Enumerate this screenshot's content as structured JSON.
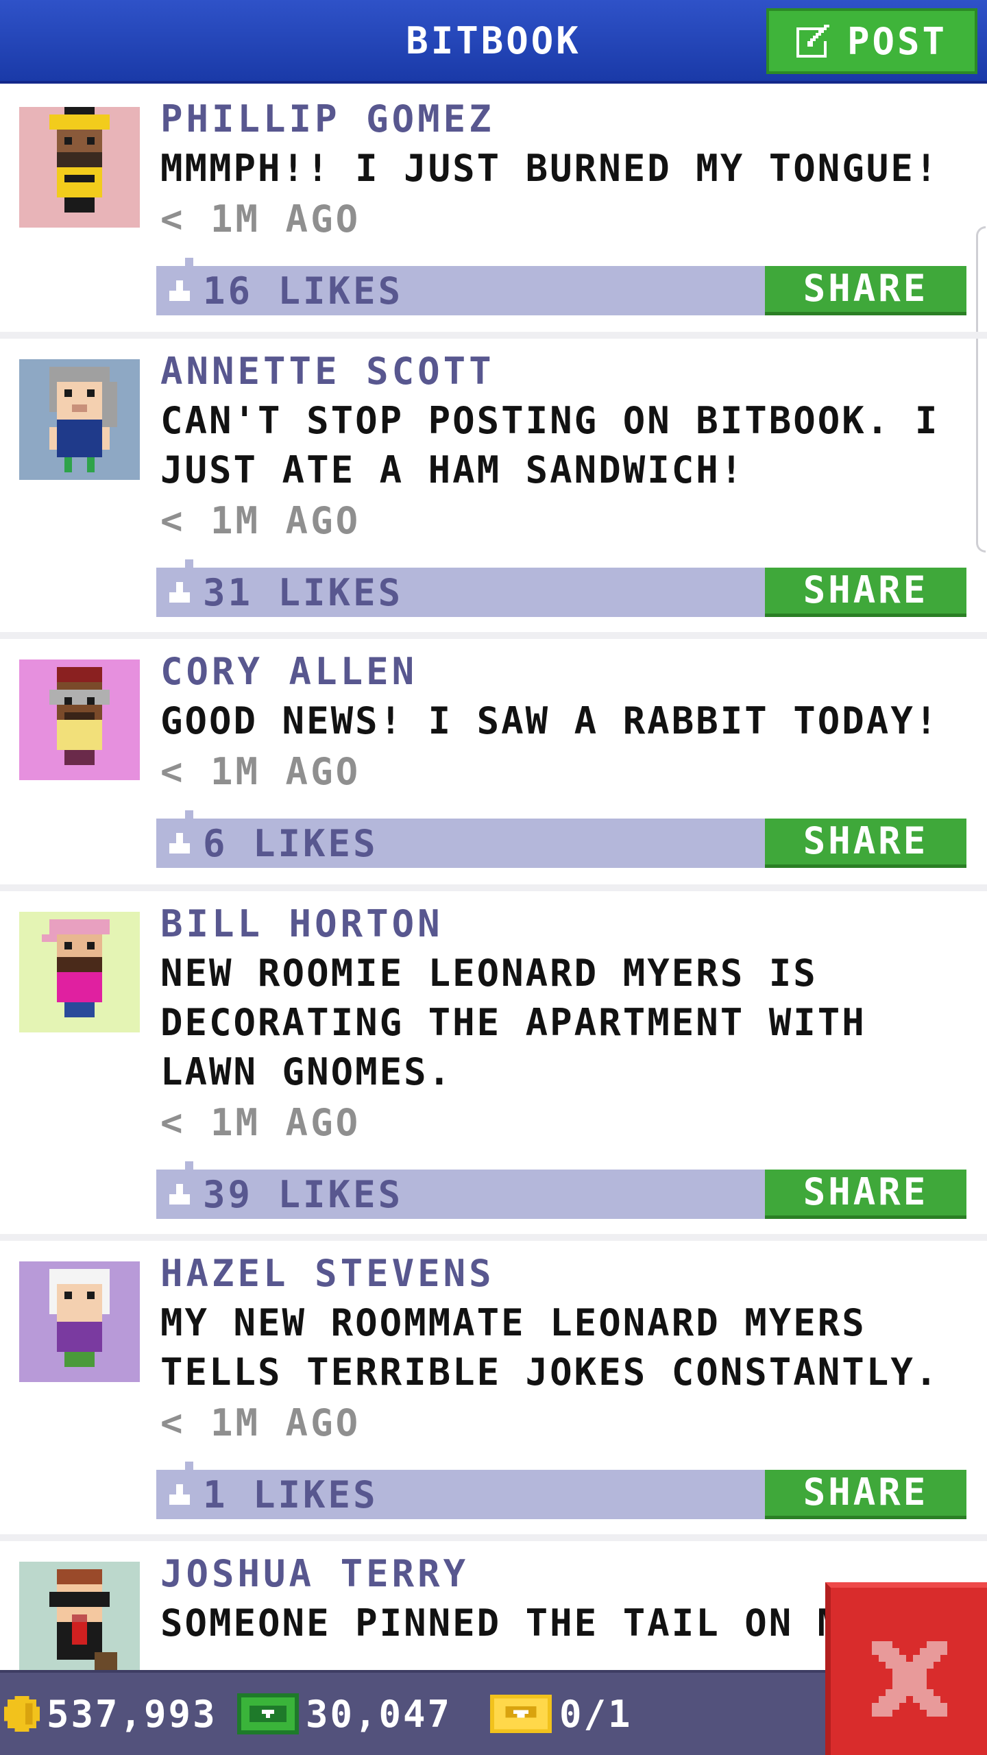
{
  "header": {
    "title": "BITBOOK",
    "post_label": "POST"
  },
  "posts": [
    {
      "author": "PHILLIP GOMEZ",
      "message": "MMMPH!! I JUST BURNED MY TONGUE!",
      "time": "< 1M AGO",
      "likes": "16 LIKES",
      "share_label": "SHARE",
      "avatar_bg": "#e8b4b8"
    },
    {
      "author": "ANNETTE SCOTT",
      "message": "CAN'T STOP POSTING ON BITBOOK. I JUST ATE A HAM SANDWICH!",
      "time": "< 1M AGO",
      "likes": "31 LIKES",
      "share_label": "SHARE",
      "avatar_bg": "#8ea8c4"
    },
    {
      "author": "CORY ALLEN",
      "message": "GOOD NEWS! I SAW A RABBIT TODAY!",
      "time": "< 1M AGO",
      "likes": "6 LIKES",
      "share_label": "SHARE",
      "avatar_bg": "#e690de"
    },
    {
      "author": "BILL HORTON",
      "message": "NEW ROOMIE LEONARD MYERS IS DECORATING THE APARTMENT WITH LAWN GNOMES.",
      "time": "< 1M AGO",
      "likes": "39 LIKES",
      "share_label": "SHARE",
      "avatar_bg": "#e4f4b4"
    },
    {
      "author": "HAZEL STEVENS",
      "message": "MY NEW ROOMMATE LEONARD MYERS TELLS TERRIBLE JOKES CONSTANTLY.",
      "time": "< 1M AGO",
      "likes": "1 LIKES",
      "share_label": "SHARE",
      "avatar_bg": "#b89ad8"
    },
    {
      "author": "JOSHUA TERRY",
      "message": "SOMEONE PINNED THE TAIL ON M",
      "time": "",
      "likes": "",
      "share_label": "",
      "avatar_bg": "#bcd8cc"
    }
  ],
  "status": {
    "coins": "537,993",
    "bux": "30,047",
    "tickets": "0/1"
  },
  "colors": {
    "header_blue": "#2f52c8",
    "share_green": "#3fa83a",
    "likes_bar": "#b4b7da",
    "name_purple": "#58578f",
    "close_red": "#d92c2c"
  },
  "icons": [
    "post-edit-icon",
    "like-thumb-icon",
    "coin-icon",
    "bux-icon",
    "ticket-icon",
    "close-icon"
  ]
}
